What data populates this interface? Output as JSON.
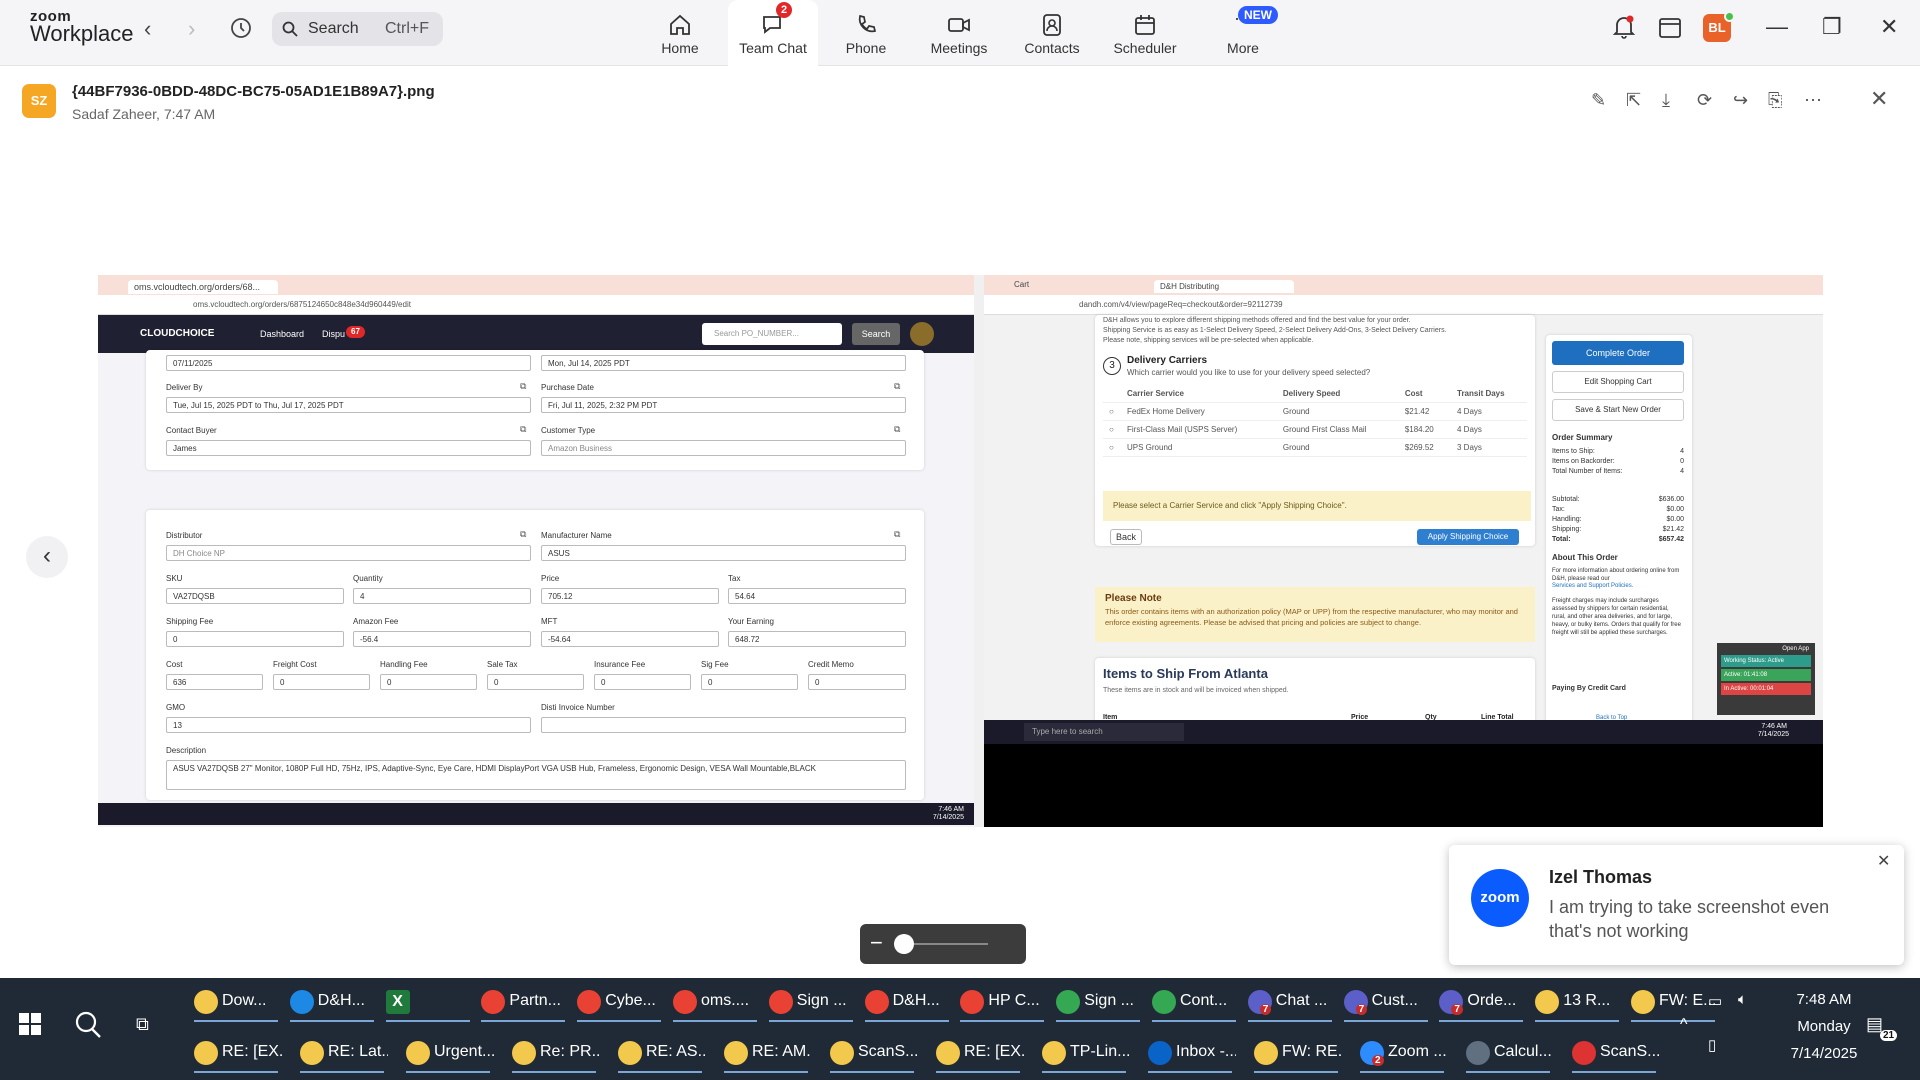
{
  "app": {
    "brand_top": "zoom",
    "brand_bottom": "Workplace"
  },
  "search": {
    "label": "Search",
    "shortcut": "Ctrl+F"
  },
  "nav": [
    {
      "label": "Home",
      "icon": "home-icon"
    },
    {
      "label": "Team Chat",
      "icon": "chat-icon",
      "badge": "2",
      "active": true
    },
    {
      "label": "Phone",
      "icon": "phone-icon"
    },
    {
      "label": "Meetings",
      "icon": "video-icon"
    },
    {
      "label": "Contacts",
      "icon": "contacts-icon"
    },
    {
      "label": "Scheduler",
      "icon": "calendar-icon"
    },
    {
      "label": "More",
      "icon": "more-icon",
      "badge": "NEW"
    }
  ],
  "user": {
    "initials": "BL",
    "color": "#e8622a",
    "status_color": "#44c24a"
  },
  "file": {
    "initials": "SZ",
    "name": "{44BF7936-0BDD-48DC-BC75-05AD1E1B89A7}.png",
    "sender": "Sadaf Zaheer, 7:47 AM"
  },
  "shot": {
    "left": {
      "tab_title": "oms.vcloudtech.org/orders/68...",
      "url": "oms.vcloudtech.org/orders/6875124650c848e34d960449/edit",
      "logo": "CLOUDCHOICE",
      "menu": [
        "Dashboard",
        "Dispu"
      ],
      "menu_badge": "67",
      "search_placeholder": "Search PO_NUMBER...",
      "search_btn": "Search",
      "fields": {
        "date1": "07/11/2025",
        "date2": "Mon, Jul 14, 2025 PDT",
        "deliver_by_lbl": "Deliver By",
        "deliver_by": "Tue, Jul 15, 2025 PDT to Thu, Jul 17, 2025 PDT",
        "purchase_date_lbl": "Purchase Date",
        "purchase_date": "Fri, Jul 11, 2025, 2:32 PM PDT",
        "contact_buyer_lbl": "Contact Buyer",
        "contact_buyer": "James",
        "customer_type_lbl": "Customer Type",
        "customer_type": "Amazon Business",
        "distributor_lbl": "Distributor",
        "distributor": "DH Choice NP",
        "manufacturer_lbl": "Manufacturer Name",
        "manufacturer": "ASUS",
        "sku_lbl": "SKU",
        "sku": "VA27DQSB",
        "qty_lbl": "Quantity",
        "qty": "4",
        "price_lbl": "Price",
        "price": "705.12",
        "tax_lbl": "Tax",
        "tax": "54.64",
        "shipfee_lbl": "Shipping Fee",
        "shipfee": "0",
        "amzfee_lbl": "Amazon Fee",
        "amzfee": "-56.4",
        "mft_lbl": "MFT",
        "mft": "-54.64",
        "earning_lbl": "Your Earning",
        "earning": "648.72",
        "cost_lbl": "Cost",
        "cost": "636",
        "freight_lbl": "Freight Cost",
        "freight": "0",
        "handling_lbl": "Handling Fee",
        "handling": "0",
        "saletax_lbl": "Sale Tax",
        "saletax": "0",
        "insurance_lbl": "Insurance Fee",
        "insurance": "0",
        "sigfee_lbl": "Sig Fee",
        "sigfee": "0",
        "credit_lbl": "Credit Memo",
        "credit": "0",
        "gmo_lbl": "GMO",
        "gmo": "13",
        "disti_lbl": "Disti Invoice Number",
        "disti": "",
        "desc_lbl": "Description",
        "desc": "ASUS VA27DQSB 27\" Monitor, 1080P Full HD, 75Hz, IPS, Adaptive-Sync, Eye Care, HDMI DisplayPort VGA USB Hub, Frameless, Ergonomic Design, VESA Wall Mountable,BLACK"
      },
      "clock_time": "7:46 AM",
      "clock_date": "7/14/2025"
    },
    "right": {
      "tab1": "Cart",
      "tab2": "D&H Distributing",
      "url": "dandh.com/v4/view/pageReq=checkout&order=92112739",
      "intro1": "D&H allows you to explore different shipping methods offered and find the best value for your order.",
      "intro2": "Shipping Service is as easy as 1-Select Delivery Speed, 2-Select Delivery Add-Ons, 3-Select Delivery Carriers.",
      "intro3": "Please note, shipping services will be pre-selected when applicable.",
      "step": "3",
      "carriers_title": "Delivery Carriers",
      "carriers_sub": "Which carrier would you like to use for your delivery speed selected?",
      "cols": [
        "Carrier Service",
        "Delivery Speed",
        "Cost",
        "Transit Days"
      ],
      "rows": [
        [
          "FedEx Home Delivery",
          "Ground",
          "$21.42",
          "4 Days"
        ],
        [
          "First-Class Mail (USPS Server)",
          "Ground First Class Mail",
          "$184.20",
          "4 Days"
        ],
        [
          "UPS Ground",
          "Ground",
          "$269.52",
          "3 Days"
        ]
      ],
      "notice": "Please select a Carrier Service and click \"Apply Shipping Choice\".",
      "back": "Back",
      "apply": "Apply Shipping Choice",
      "note_title": "Please Note",
      "note_text": "This order contains items with an authorization policy (MAP or UPP) from the respective manufacturer, who may monitor and enforce existing agreements. Please be advised that pricing and policies are subject to change.",
      "items_title": "Items to Ship From Atlanta",
      "items_sub": "These items are in stock and will be invoiced when shipped.",
      "item_cols": [
        "Item",
        "Price",
        "Qty",
        "Line Total"
      ],
      "complete": "Complete Order",
      "edit_cart": "Edit Shopping Cart",
      "save_new": "Save & Start New Order",
      "summary_title": "Order Summary",
      "summary": [
        [
          "Items to Ship:",
          "4"
        ],
        [
          "Items on Backorder:",
          "0"
        ],
        [
          "Total Number of Items:",
          "4"
        ]
      ],
      "totals": [
        [
          "Subtotal:",
          "$636.00"
        ],
        [
          "Tax:",
          "$0.00"
        ],
        [
          "Handling:",
          "$0.00"
        ],
        [
          "Shipping:",
          "$21.42"
        ],
        [
          "Total:",
          "$657.42"
        ]
      ],
      "about_title": "About This Order",
      "about1": "For more information about ordering online from D&H, please read our",
      "about_link": "Services and Support Policies.",
      "about2": "Freight charges may include surcharges assessed by shippers for certain residential, rural, and other area deliveries, and for large, heavy, or bulky items. Orders that qualify for free freight will still be applied these surcharges.",
      "paying": "Paying By Credit Card",
      "back_top": "Back to Top",
      "status": {
        "open": "Open App",
        "working": "Working Status: Active",
        "active": "Active: 01:41:08",
        "inactive": "In Active: 00:01:04"
      },
      "search_ph": "Type here to search",
      "clock_time": "7:46 AM",
      "clock_date": "7/14/2025"
    }
  },
  "toast": {
    "name": "Izel Thomas",
    "message": "I am trying to take screenshot even that's not working",
    "logo": "zoom"
  },
  "taskbar": {
    "row1": [
      {
        "label": "Dow...",
        "color": "#f2c94c"
      },
      {
        "label": "D&H...",
        "color": "#1e88e5"
      },
      {
        "label": "",
        "color": "#1f7a3c",
        "glyph": "X"
      },
      {
        "label": "Partn...",
        "color": "#e94235"
      },
      {
        "label": "Cybe...",
        "color": "#e94235"
      },
      {
        "label": "oms....",
        "color": "#e94235"
      },
      {
        "label": "Sign ...",
        "color": "#e94235"
      },
      {
        "label": "D&H...",
        "color": "#e94235"
      },
      {
        "label": "HP C...",
        "color": "#e94235"
      },
      {
        "label": "Sign ...",
        "color": "#34a853"
      },
      {
        "label": "Cont...",
        "color": "#34a853"
      },
      {
        "label": "Chat ...",
        "color": "#5b5fc7",
        "num": "7"
      },
      {
        "label": "Cust...",
        "color": "#5b5fc7",
        "num": "7"
      },
      {
        "label": "Orde...",
        "color": "#5b5fc7",
        "num": "7"
      },
      {
        "label": "13 R...",
        "color": "#f2c94c"
      },
      {
        "label": "FW: E...",
        "color": "#f2c94c"
      }
    ],
    "row2": [
      {
        "label": "RE: [EX...",
        "color": "#f2c94c"
      },
      {
        "label": "RE: Lat...",
        "color": "#f2c94c"
      },
      {
        "label": "Urgent...",
        "color": "#f2c94c"
      },
      {
        "label": "Re: PR...",
        "color": "#f2c94c"
      },
      {
        "label": "RE: AS...",
        "color": "#f2c94c"
      },
      {
        "label": "RE: AM...",
        "color": "#f2c94c"
      },
      {
        "label": "ScanS...",
        "color": "#f2c94c"
      },
      {
        "label": "RE: [EX...",
        "color": "#f2c94c"
      },
      {
        "label": "TP-Lin...",
        "color": "#f2c94c"
      },
      {
        "label": "Inbox -...",
        "color": "#0a64c8"
      },
      {
        "label": "FW: RE...",
        "color": "#f2c94c"
      },
      {
        "label": "Zoom ...",
        "color": "#2d8cff",
        "num": "2"
      },
      {
        "label": "Calcul...",
        "color": "#607080"
      },
      {
        "label": "ScanS...",
        "color": "#d33"
      }
    ],
    "clock_time": "7:48 AM",
    "clock_day": "Monday",
    "clock_date": "7/14/2025",
    "notif_count": "21"
  }
}
